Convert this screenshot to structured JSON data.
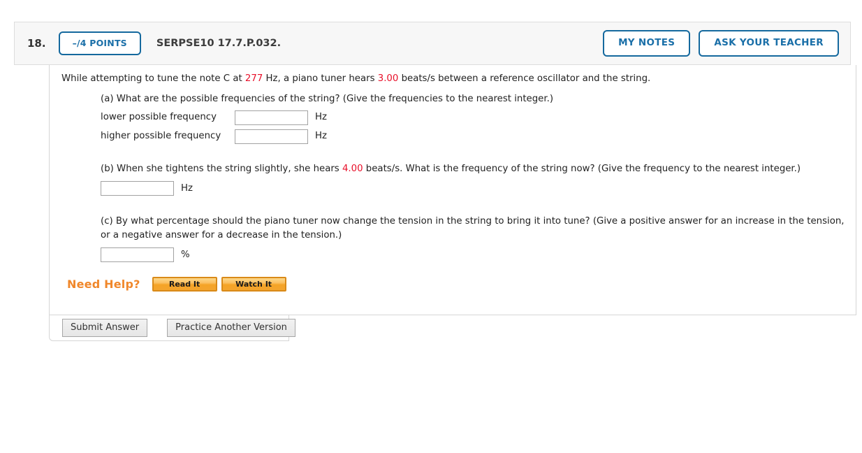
{
  "header": {
    "question_number": "18.",
    "points_badge": "–/4 POINTS",
    "question_code": "SERPSE10 17.7.P.032.",
    "my_notes_label": "MY NOTES",
    "ask_teacher_label": "ASK YOUR TEACHER"
  },
  "stem": {
    "text_1": "While attempting to tune the note C at ",
    "value_frequency": "277",
    "text_2": " Hz, a piano tuner hears ",
    "value_beats": "3.00",
    "text_3": " beats/s between a reference oscillator and the string."
  },
  "parts": {
    "a": {
      "prompt": "(a) What are the possible frequencies of the string? (Give the frequencies to the nearest integer.)",
      "lower_label": "lower possible frequency",
      "lower_value": "",
      "lower_unit": "Hz",
      "higher_label": "higher possible frequency",
      "higher_value": "",
      "higher_unit": "Hz"
    },
    "b": {
      "prompt_1": "(b) When she tightens the string slightly, she hears ",
      "value_beats": "4.00",
      "prompt_2": " beats/s. What is the frequency of the string now? (Give the frequency to the nearest integer.)",
      "value": "",
      "unit": "Hz"
    },
    "c": {
      "prompt": "(c) By what percentage should the piano tuner now change the tension in the string to bring it into tune? (Give a positive answer for an increase in the tension, or a negative answer for a decrease in the tension.)",
      "value": "",
      "unit": "%"
    }
  },
  "need_help": {
    "label": "Need Help?",
    "read_it_label": "Read It",
    "watch_it_label": "Watch It"
  },
  "footer": {
    "submit_label": "Submit Answer",
    "practice_label": "Practice Another Version"
  },
  "colors": {
    "accent_blue": "#1a6fa8",
    "border_blue": "#15699e",
    "red_value": "#e8102a",
    "orange_help": "#f0872a",
    "orange_button_border": "#d98a18",
    "header_bg": "#f7f7f7",
    "card_border": "#d6d6d6"
  }
}
